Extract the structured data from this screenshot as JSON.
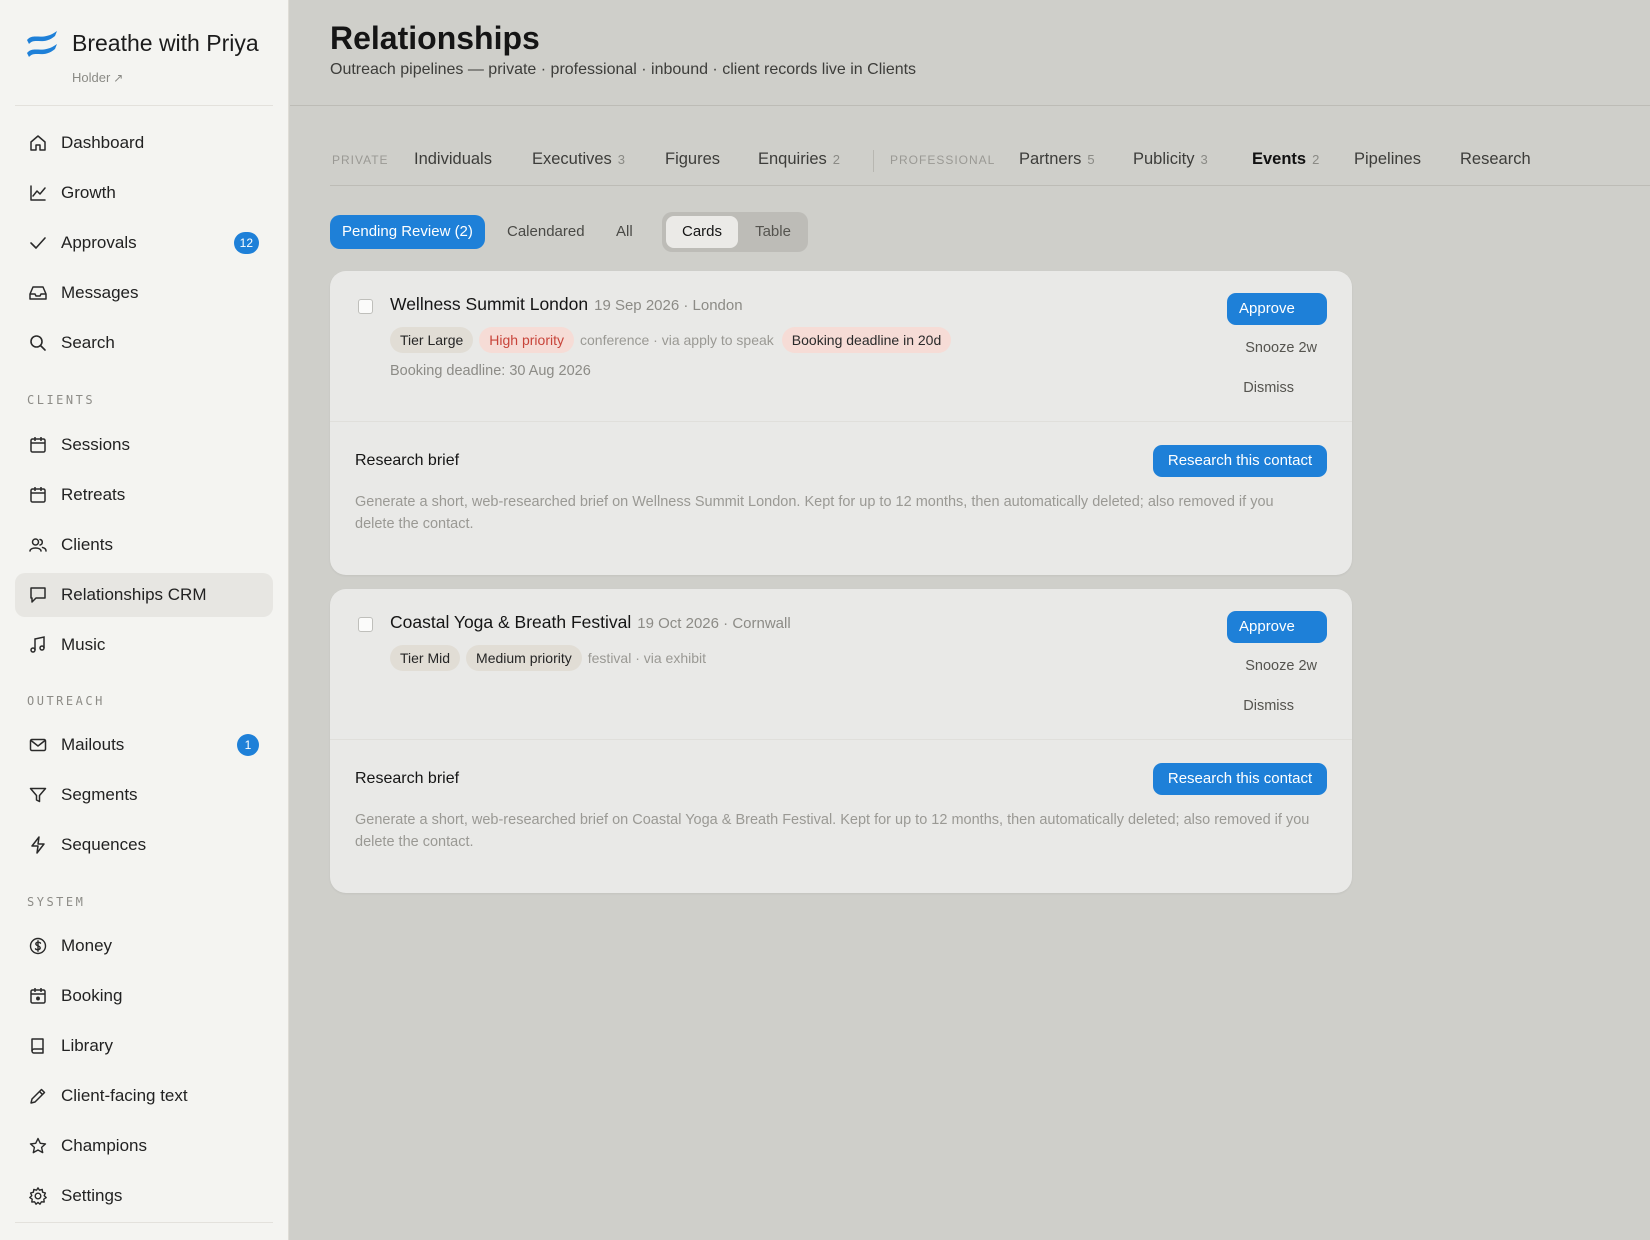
{
  "brand": {
    "name": "Breathe with Priya",
    "sub": "Holder",
    "sub_icon": "arrow-up-right-icon",
    "accent": "#1e80d8"
  },
  "sidebar": {
    "items": [
      {
        "label": "Dashboard",
        "icon": "home-icon"
      },
      {
        "label": "Growth",
        "icon": "chart-line-icon"
      },
      {
        "label": "Approvals",
        "icon": "check-icon",
        "badge": "12"
      },
      {
        "label": "Messages",
        "icon": "inbox-icon"
      },
      {
        "label": "Search",
        "icon": "search-icon"
      }
    ],
    "clients_label": "CLIENTS",
    "clients_items": [
      {
        "label": "Sessions",
        "icon": "calendar-icon"
      },
      {
        "label": "Retreats",
        "icon": "calendar-icon"
      },
      {
        "label": "Clients",
        "icon": "users-icon"
      },
      {
        "label": "Relationships CRM",
        "icon": "chat-icon",
        "active": true
      },
      {
        "label": "Music",
        "icon": "music-icon"
      }
    ],
    "outreach_label": "OUTREACH",
    "outreach_items": [
      {
        "label": "Mailouts",
        "icon": "mail-icon",
        "badge": "1"
      },
      {
        "label": "Segments",
        "icon": "filter-icon"
      },
      {
        "label": "Sequences",
        "icon": "bolt-icon"
      }
    ],
    "system_label": "SYSTEM",
    "system_items": [
      {
        "label": "Money",
        "icon": "dollar-icon"
      },
      {
        "label": "Booking",
        "icon": "calendar-dot-icon"
      },
      {
        "label": "Library",
        "icon": "book-icon"
      },
      {
        "label": "Client-facing text",
        "icon": "pencil-icon"
      },
      {
        "label": "Champions",
        "icon": "star-icon"
      },
      {
        "label": "Settings",
        "icon": "gear-icon"
      }
    ]
  },
  "header": {
    "title": "Relationships",
    "subtitle": "Outreach pipelines — private · professional · inbound · client records live in Clients"
  },
  "tabs": {
    "private_label": "PRIVATE",
    "professional_label": "PROFESSIONAL",
    "items": [
      {
        "label": "Individuals",
        "count": ""
      },
      {
        "label": "Executives",
        "count": "3"
      },
      {
        "label": "Figures",
        "count": ""
      },
      {
        "label": "Enquiries",
        "count": "2"
      },
      {
        "label": "Partners",
        "count": "5"
      },
      {
        "label": "Publicity",
        "count": "3"
      },
      {
        "label": "Events",
        "count": "2",
        "active": true
      },
      {
        "label": "Pipelines",
        "count": ""
      },
      {
        "label": "Research",
        "count": ""
      }
    ]
  },
  "filters": {
    "pending": "Pending Review (2)",
    "calendared": "Calendared",
    "all": "All",
    "view_cards": "Cards",
    "view_table": "Table"
  },
  "cards": [
    {
      "title": "Wellness Summit London",
      "meta": "19 Sep 2026 · London",
      "tier": "Tier Large",
      "priority": "High priority",
      "kind": "conference · via apply to speak",
      "warning": "Booking deadline in 20d",
      "deadline": "Booking deadline: 30 Aug 2026",
      "approve": "Approve",
      "snooze": "Snooze 2w",
      "dismiss": "Dismiss",
      "brief_title": "Research brief",
      "research_button": "Research this contact",
      "brief_text": "Generate a short, web-researched brief on Wellness Summit London. Kept for up to 12 months, then automatically deleted; also removed if you delete the contact."
    },
    {
      "title": "Coastal Yoga & Breath Festival",
      "meta": "19 Oct 2026 · Cornwall",
      "tier": "Tier Mid",
      "priority": "Medium priority",
      "kind": "festival · via exhibit",
      "approve": "Approve",
      "snooze": "Snooze 2w",
      "dismiss": "Dismiss",
      "brief_title": "Research brief",
      "research_button": "Research this contact",
      "brief_text": "Generate a short, web-researched brief on Coastal Yoga & Breath Festival. Kept for up to 12 months, then automatically deleted; also removed if you delete the contact."
    }
  ]
}
